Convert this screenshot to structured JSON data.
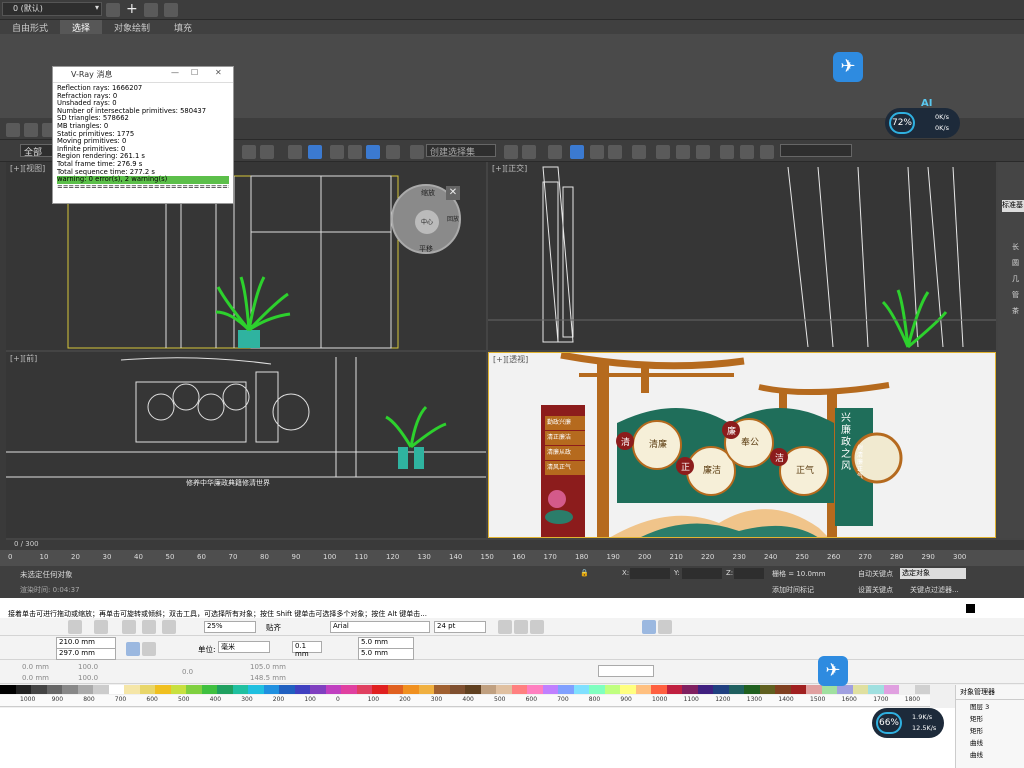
{
  "max": {
    "layer_name": "0 (默认)",
    "tabs": [
      "自由形式",
      "选择",
      "对象绘制",
      "填充"
    ],
    "selected_tab": 1,
    "view_dropdown": "全部",
    "selection_set": "创建选择集",
    "viewports": {
      "top_left": "[+][视图]",
      "top_right": "[+][正交]",
      "bottom_left": "[+][前]",
      "bottom_right": "[+][透视]"
    },
    "nav_wheel": {
      "zoom": "缩放",
      "orbit": "动态观察",
      "center": "中心",
      "rewind": "回放",
      "pan": "平移",
      "look": "环视",
      "walk": "漫游",
      "up_down": "向上/向下"
    },
    "time_slider": "0 / 300",
    "timeline_ticks": [
      "0",
      "10",
      "20",
      "30",
      "40",
      "50",
      "60",
      "70",
      "80",
      "90",
      "100",
      "110",
      "120",
      "130",
      "140",
      "150",
      "160",
      "170",
      "180",
      "190",
      "200",
      "210",
      "220",
      "230",
      "240",
      "250",
      "260",
      "270",
      "280",
      "290",
      "300"
    ],
    "status": "未选定任何对象",
    "render_time": "渲染时间: 0:04:37",
    "grid": "栅格 = 10.0mm",
    "auto_key": "自动关键点",
    "set_key": "设置关键点",
    "key_filter": "选定对象",
    "add_time_tag": "添加时间标记",
    "key_filters_label": "关键点过滤器...",
    "coord_labels": [
      "X:",
      "Y:",
      "Z:"
    ],
    "right_panel": [
      "标准基",
      "长",
      "圆",
      "几",
      "管",
      "茶"
    ],
    "ai_label": "AI",
    "cpu_pct": "72%",
    "net_up": "0K/s",
    "net_down": "0K/s"
  },
  "vray": {
    "title": "V-Ray 消息",
    "lines": [
      "Reflection rays: 1666207",
      "Refraction rays: 0",
      "Unshaded rays: 0",
      "Number of intersectable primitives: 580437",
      "SD triangles: 578662",
      "MB triangles: 0",
      "Static primitives: 1775",
      "Moving primitives: 0",
      "Infinite primitives: 0",
      "Region rendering: 261.1 s",
      "Total frame time: 276.9 s",
      "Total sequence time: 277.2 s"
    ],
    "warning": "warning: 0 error(s), 2 warning(s)",
    "separator": "======================================"
  },
  "scene": {
    "panel_left": [
      "勤政兴廉",
      "清正廉洁",
      "清廉从政",
      "清风正气"
    ],
    "vertical_title": "兴廉政之风",
    "vertical_sub": "树清廉正气",
    "circles": [
      {
        "top": "清",
        "text": "清廉"
      },
      {
        "top": "正",
        "text": "廉洁"
      },
      {
        "top": "廉",
        "text": "奉公"
      },
      {
        "top": "洁",
        "text": "正气"
      }
    ],
    "cad_caption": "修养中华廉政典籍修清世界"
  },
  "coreldraw": {
    "hint": "接着单击可进行拖动或缩放；再单击可旋转或倾斜；双击工具，可选择所有对象；按住 Shift 键单击可选择多个对象；按住 Alt 键单击...",
    "zoom": "25%",
    "snap": "贴齐",
    "font": "Arial",
    "font_size": "24 pt",
    "width": "210.0 mm",
    "height": "297.0 mm",
    "units_label": "单位:",
    "units": "毫米",
    "nudge": "0.1 mm",
    "dup_x": "5.0 mm",
    "dup_y": "5.0 mm",
    "pos_x": "0.0 mm",
    "pos_y": "0.0 mm",
    "scale_x": "100.0",
    "scale_y": "100.0",
    "angle": "0.0",
    "obj_x": "105.0 mm",
    "obj_y": "148.5 mm",
    "ruler_ticks": [
      "1000",
      "900",
      "800",
      "700",
      "600",
      "500",
      "400",
      "300",
      "200",
      "100",
      "0",
      "100",
      "200",
      "300",
      "400",
      "500",
      "600",
      "700",
      "800",
      "900",
      "1000",
      "1100",
      "1200",
      "1300",
      "1400",
      "1500",
      "1600",
      "1700",
      "1800"
    ],
    "obj_manager": "对象管理器",
    "obj_items": [
      "图层 3",
      "矩形",
      "矩形",
      "曲线",
      "曲线"
    ],
    "cpu_pct": "66%",
    "net_up": "1.9K/s",
    "net_down": "12.5K/s"
  },
  "colors": {
    "accent_yellow": "#e2b431",
    "vray_warning": "#5cbf4a",
    "gate_brown": "#b56a1e",
    "panel_green": "#1f6e5a",
    "panel_red": "#8c1c1c",
    "plant_green": "#2dd12d"
  }
}
